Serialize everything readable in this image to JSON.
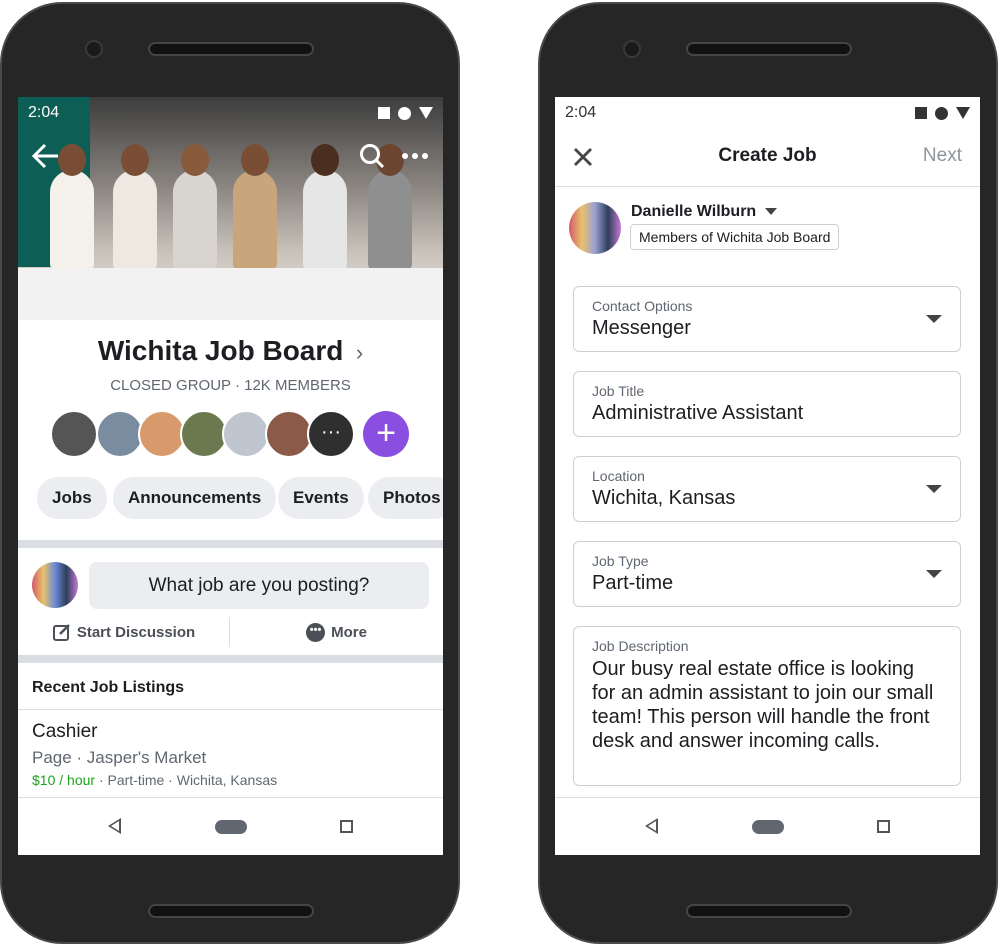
{
  "left": {
    "status": {
      "time": "2:04"
    },
    "group": {
      "name": "Wichita Job Board",
      "meta": "CLOSED GROUP · 12K MEMBERS"
    },
    "tabs": [
      {
        "label": "Jobs"
      },
      {
        "label": "Announcements"
      },
      {
        "label": "Events"
      },
      {
        "label": "Photos"
      }
    ],
    "composer": {
      "placeholder": "What job are you posting?",
      "start_discussion": "Start Discussion",
      "more": "More"
    },
    "listings": {
      "heading": "Recent Job Listings",
      "items": [
        {
          "title": "Cashier",
          "source": "Page · Jasper's Market",
          "pay": "$10 / hour",
          "details": " · Part-time · Wichita, Kansas"
        }
      ]
    },
    "accent": "#8a4fe0",
    "pay_color": "#1ba31b"
  },
  "right": {
    "status": {
      "time": "2:04"
    },
    "header": {
      "title": "Create Job",
      "next": "Next"
    },
    "author": {
      "name": "Danielle Wilburn",
      "audience": "Members of Wichita Job Board"
    },
    "fields": [
      {
        "label": "Contact Options",
        "value": "Messenger",
        "dropdown": true
      },
      {
        "label": "Job Title",
        "value": "Administrative Assistant",
        "dropdown": false
      },
      {
        "label": "Location",
        "value": "Wichita, Kansas",
        "dropdown": true
      },
      {
        "label": "Job Type",
        "value": "Part-time",
        "dropdown": true
      },
      {
        "label": "Job Description",
        "value": "Our busy real estate office is looking for an admin assistant to join our small team! This person will handle the front desk and answer incoming calls.",
        "dropdown": false
      }
    ]
  }
}
